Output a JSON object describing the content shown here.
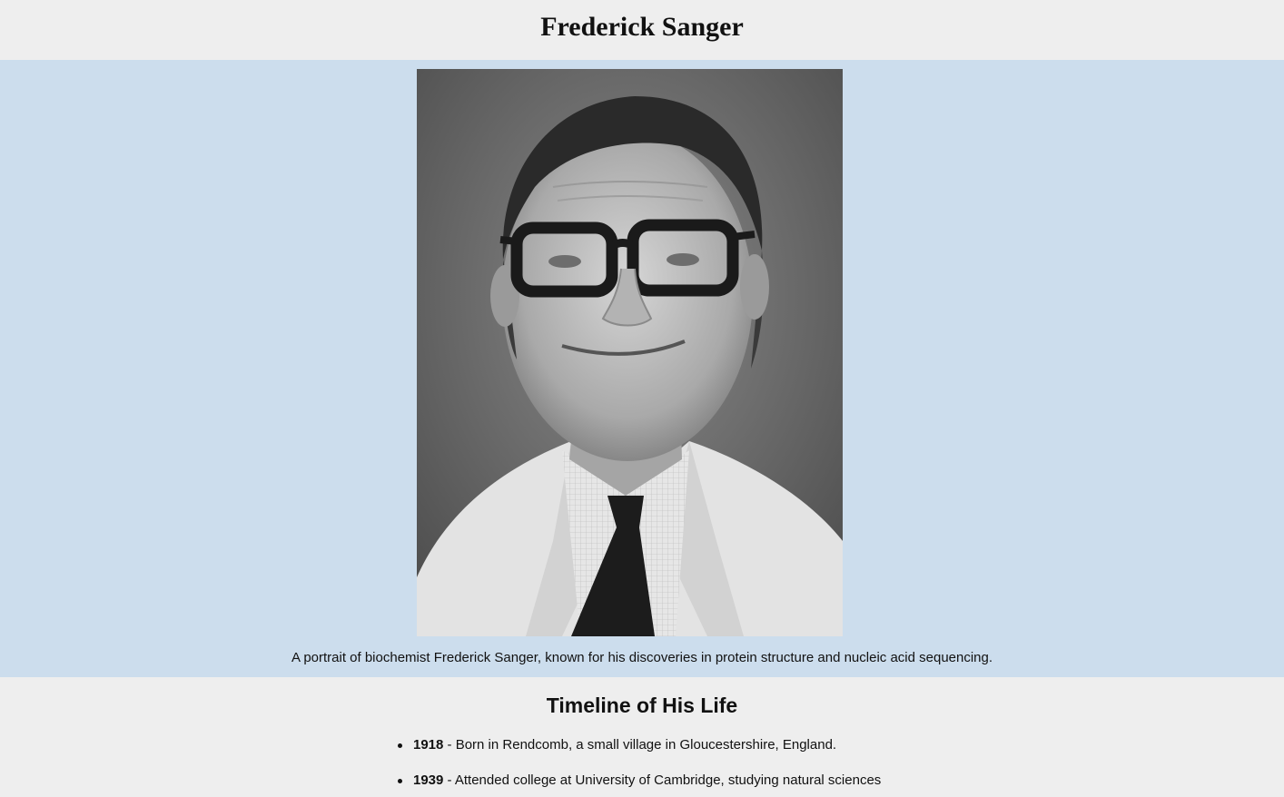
{
  "header": {
    "title": "Frederick Sanger"
  },
  "portrait": {
    "caption": "A portrait of biochemist Frederick Sanger, known for his discoveries in protein structure and nucleic acid sequencing."
  },
  "timeline": {
    "heading": "Timeline of His Life",
    "events": [
      {
        "year": "1918",
        "text": " - Born in Rendcomb, a small village in Gloucestershire, England."
      },
      {
        "year": "1939",
        "text": " - Attended college at University of Cambridge, studying natural sciences"
      }
    ]
  }
}
